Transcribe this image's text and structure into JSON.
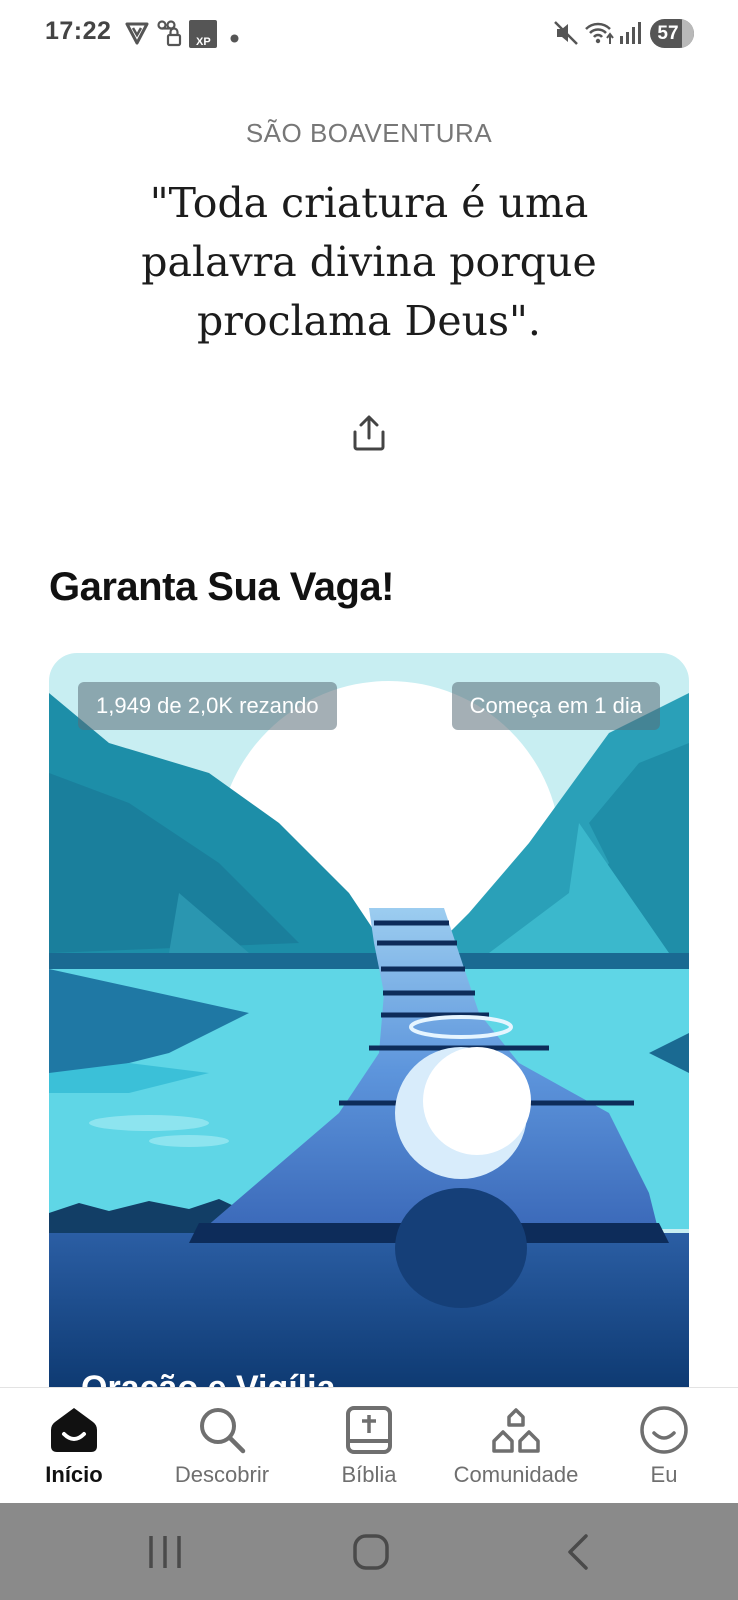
{
  "status_bar": {
    "time": "17:22",
    "battery_level": "57",
    "left_icons": [
      "vpn-shield-icon",
      "voicemail-lock-icon",
      "xp-app-icon",
      "notification-dot-icon"
    ],
    "right_icons": [
      "mute-icon",
      "wifi-icon",
      "signal-icon",
      "battery-icon"
    ]
  },
  "quote": {
    "author": "SÃO BOAVENTURA",
    "text": "\"Toda criatura é uma palavra divina porque proclama Deus\".",
    "share_icon": "share-icon"
  },
  "section": {
    "title": "Garanta Sua Vaga!"
  },
  "card": {
    "participants": "1,949 de 2,0K rezando",
    "starts": "Começa em 1 dia",
    "title": "Oração e Vigília",
    "colors": {
      "sky": "#c8eef2",
      "sun": "#ffffff",
      "mountain_left": "#1d8ea8",
      "mountain_right": "#2aa0b8",
      "water": "#5fd6e6",
      "path": "#4a7ed0",
      "deep": "#0e3a72"
    }
  },
  "bottom_nav": {
    "items": [
      {
        "label": "Início",
        "icon": "home-smile-icon",
        "active": true
      },
      {
        "label": "Descobrir",
        "icon": "search-icon",
        "active": false
      },
      {
        "label": "Bíblia",
        "icon": "bible-icon",
        "active": false
      },
      {
        "label": "Comunidade",
        "icon": "community-icon",
        "active": false
      },
      {
        "label": "Eu",
        "icon": "profile-smile-icon",
        "active": false
      }
    ]
  },
  "system_nav": {
    "buttons": [
      "recent-apps-icon",
      "home-icon",
      "back-icon"
    ]
  }
}
